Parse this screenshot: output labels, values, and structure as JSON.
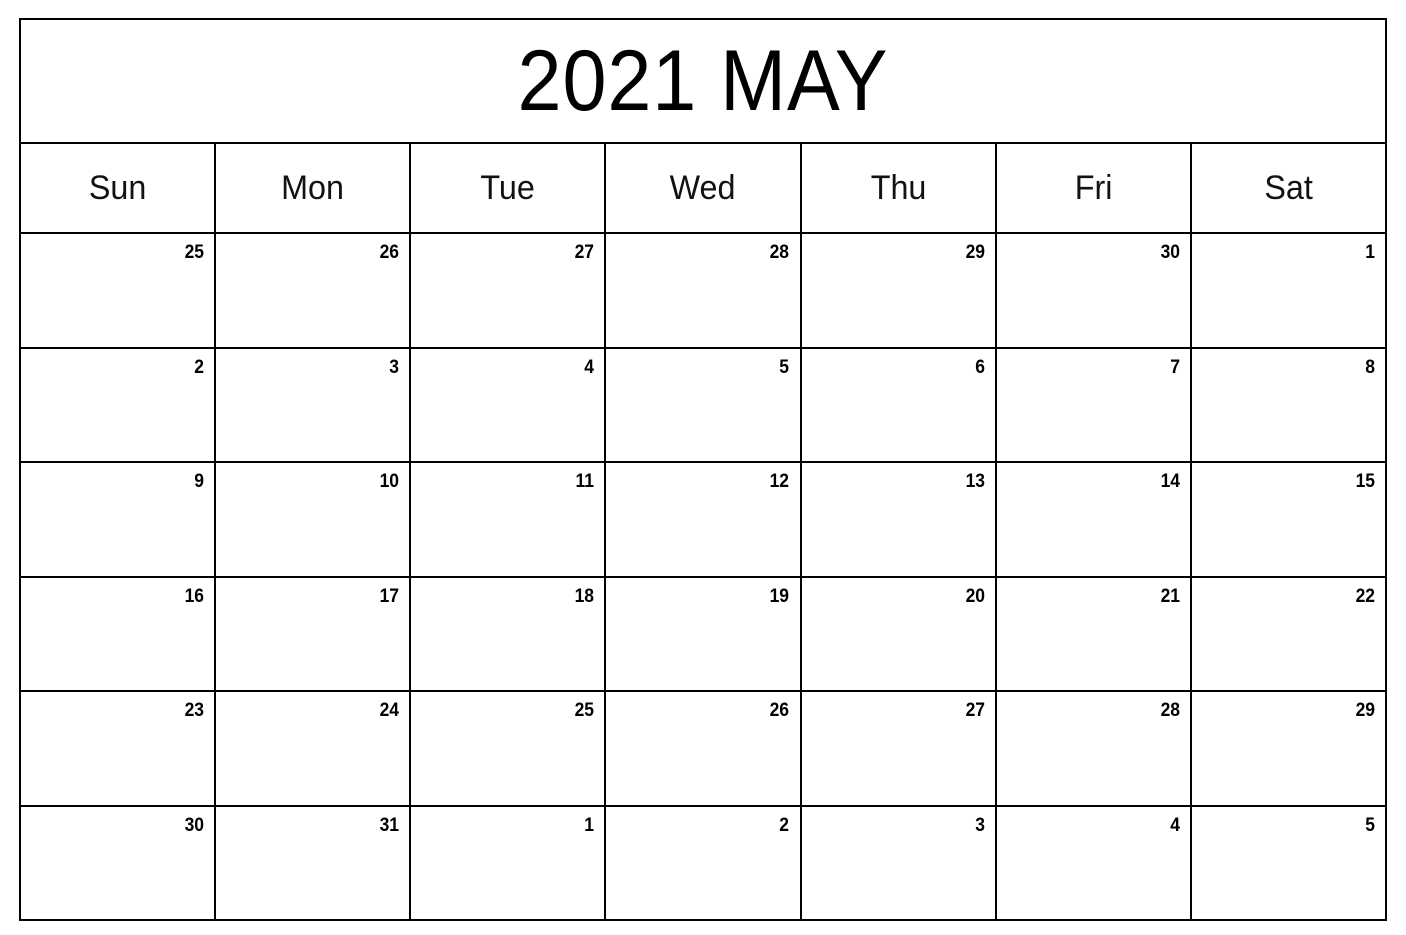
{
  "document": {
    "type": "printable-monthly-calendar",
    "title": "2021 MAY",
    "year": "2021",
    "month": "MAY"
  },
  "colors": {
    "page_background": "#ffffff",
    "grid_border": "#000000",
    "weekday_header_background": "#dcdcdc",
    "weekday_header_text": "#121212",
    "day_number_text": "#000000",
    "title_text": "#000000"
  },
  "weekdays": [
    {
      "label": "Sun",
      "name": "sunday"
    },
    {
      "label": "Mon",
      "name": "monday"
    },
    {
      "label": "Tue",
      "name": "tuesday"
    },
    {
      "label": "Wed",
      "name": "wednesday"
    },
    {
      "label": "Thu",
      "name": "thursday"
    },
    {
      "label": "Fri",
      "name": "friday"
    },
    {
      "label": "Sat",
      "name": "saturday"
    }
  ],
  "weeks": [
    {
      "index": 1,
      "days": [
        {
          "number": "25",
          "in_month": false
        },
        {
          "number": "26",
          "in_month": false
        },
        {
          "number": "27",
          "in_month": false
        },
        {
          "number": "28",
          "in_month": false
        },
        {
          "number": "29",
          "in_month": false
        },
        {
          "number": "30",
          "in_month": false
        },
        {
          "number": "1",
          "in_month": true
        }
      ]
    },
    {
      "index": 2,
      "days": [
        {
          "number": "2",
          "in_month": true
        },
        {
          "number": "3",
          "in_month": true
        },
        {
          "number": "4",
          "in_month": true
        },
        {
          "number": "5",
          "in_month": true
        },
        {
          "number": "6",
          "in_month": true
        },
        {
          "number": "7",
          "in_month": true
        },
        {
          "number": "8",
          "in_month": true
        }
      ]
    },
    {
      "index": 3,
      "days": [
        {
          "number": "9",
          "in_month": true
        },
        {
          "number": "10",
          "in_month": true
        },
        {
          "number": "11",
          "in_month": true
        },
        {
          "number": "12",
          "in_month": true
        },
        {
          "number": "13",
          "in_month": true
        },
        {
          "number": "14",
          "in_month": true
        },
        {
          "number": "15",
          "in_month": true
        }
      ]
    },
    {
      "index": 4,
      "days": [
        {
          "number": "16",
          "in_month": true
        },
        {
          "number": "17",
          "in_month": true
        },
        {
          "number": "18",
          "in_month": true
        },
        {
          "number": "19",
          "in_month": true
        },
        {
          "number": "20",
          "in_month": true
        },
        {
          "number": "21",
          "in_month": true
        },
        {
          "number": "22",
          "in_month": true
        }
      ]
    },
    {
      "index": 5,
      "days": [
        {
          "number": "23",
          "in_month": true
        },
        {
          "number": "24",
          "in_month": true
        },
        {
          "number": "25",
          "in_month": true
        },
        {
          "number": "26",
          "in_month": true
        },
        {
          "number": "27",
          "in_month": true
        },
        {
          "number": "28",
          "in_month": true
        },
        {
          "number": "29",
          "in_month": true
        }
      ]
    },
    {
      "index": 6,
      "days": [
        {
          "number": "30",
          "in_month": true
        },
        {
          "number": "31",
          "in_month": true
        },
        {
          "number": "1",
          "in_month": false
        },
        {
          "number": "2",
          "in_month": false
        },
        {
          "number": "3",
          "in_month": false
        },
        {
          "number": "4",
          "in_month": false
        },
        {
          "number": "5",
          "in_month": false
        }
      ]
    }
  ]
}
